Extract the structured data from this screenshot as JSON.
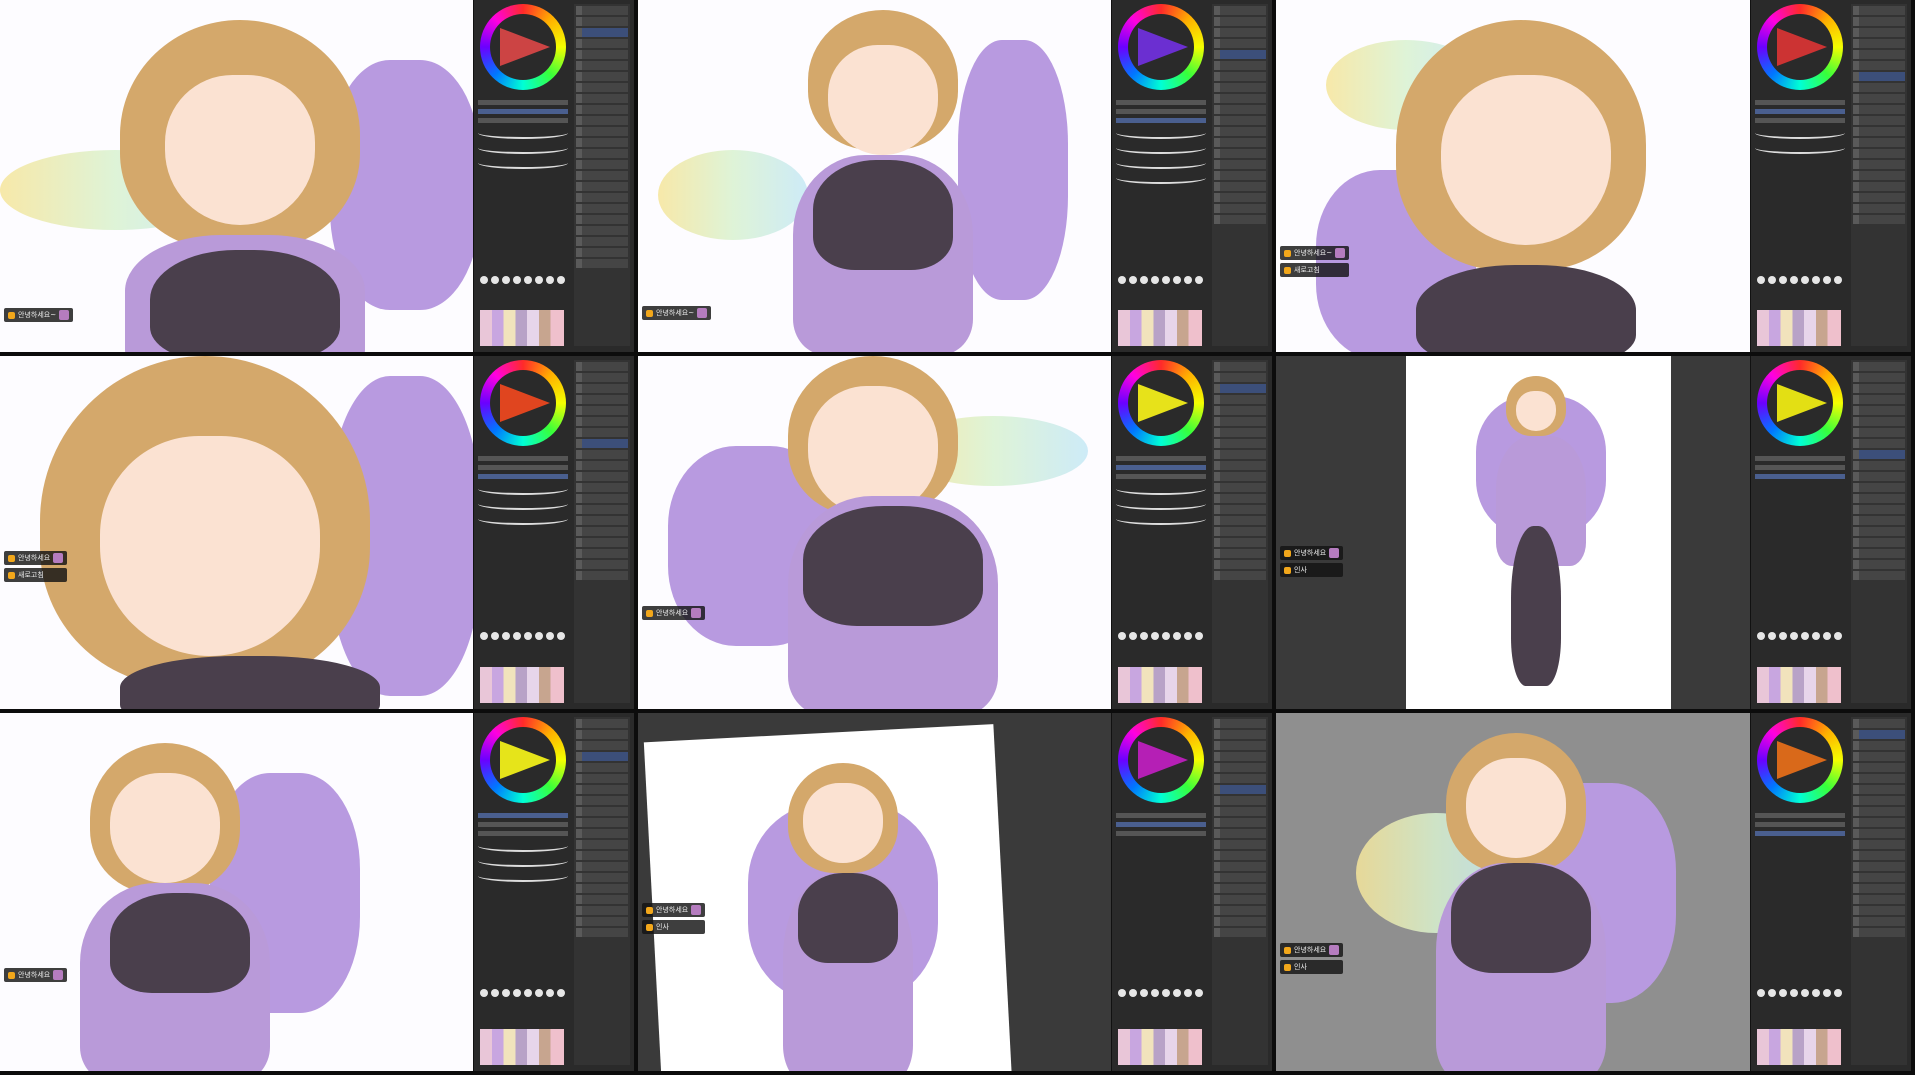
{
  "layout": {
    "columns": 3,
    "rows": 3
  },
  "app": {
    "name": "painting-app-timelapse-grid"
  },
  "cells": [
    {
      "id": "c1",
      "canvas_bg": "white",
      "chat": [
        "안녕하세요~"
      ]
    },
    {
      "id": "c2",
      "canvas_bg": "white",
      "chat": [
        "안녕하세요~"
      ]
    },
    {
      "id": "c3",
      "canvas_bg": "white",
      "chat": [
        "안녕하세요~",
        "새로고침"
      ]
    },
    {
      "id": "c4",
      "canvas_bg": "white",
      "chat": [
        "안녕하세요",
        "새로고침"
      ]
    },
    {
      "id": "c5",
      "canvas_bg": "white",
      "chat": [
        "안녕하세요"
      ]
    },
    {
      "id": "c6",
      "canvas_bg": "dark",
      "chat": [
        "안녕하세요",
        "인사"
      ]
    },
    {
      "id": "c7",
      "canvas_bg": "white",
      "chat": [
        "안녕하세요"
      ]
    },
    {
      "id": "c8",
      "canvas_bg": "dark",
      "chat": [
        "안녕하세요",
        "인사"
      ]
    },
    {
      "id": "c9",
      "canvas_bg": "gray",
      "chat": [
        "안녕하세요",
        "인사"
      ]
    }
  ],
  "colors": {
    "hair": "#d4a86b",
    "dress": "#b99ad9",
    "skin": "#fbe2d2",
    "stockings": "#4a3f4c",
    "panel": "#2a2a2a"
  }
}
